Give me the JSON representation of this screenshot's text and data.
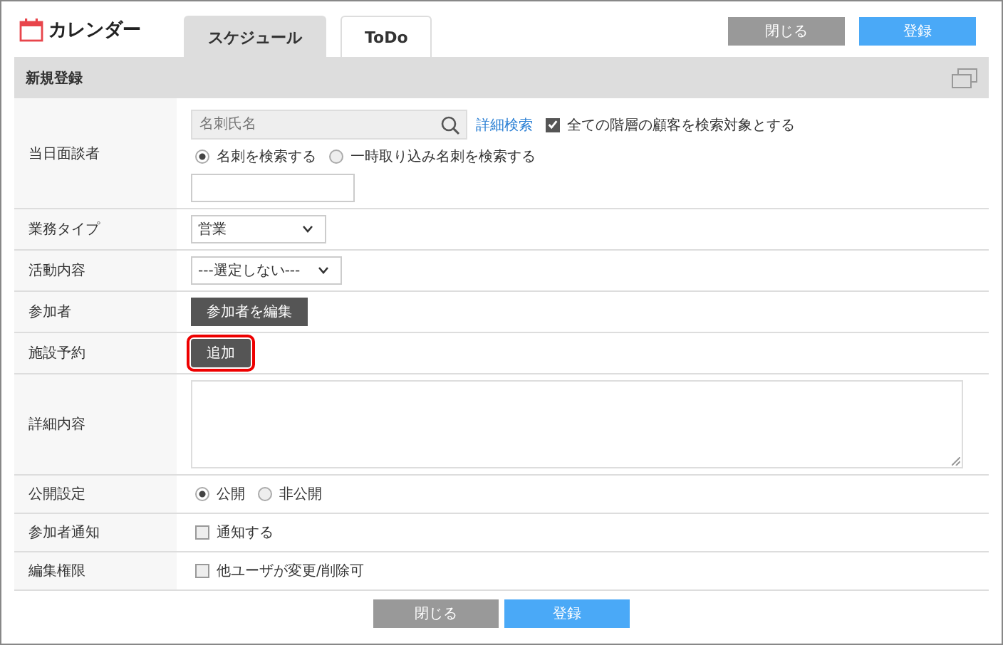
{
  "app": {
    "title": "カレンダー"
  },
  "tabs": [
    {
      "label": "スケジュール",
      "selected": true
    },
    {
      "label": "ToDo",
      "selected": false
    }
  ],
  "header_buttons": [
    {
      "label": "閉じる",
      "kind": "secondary"
    },
    {
      "label": "登録",
      "kind": "primary"
    }
  ],
  "section": {
    "title": "新規登録"
  },
  "rows": [
    {
      "label": "当日面談者",
      "kind": "visitor",
      "placeholder": "名刺氏名",
      "link": "詳細検索",
      "checkbox": {
        "label": "全ての階層の顧客を検索対象とする",
        "checked": true
      },
      "options": [
        {
          "label": "名刺を検索する",
          "selected": true
        },
        {
          "label": "一時取り込み名刺を検索する",
          "selected": false
        }
      ]
    },
    {
      "label": "業務タイプ",
      "kind": "select",
      "value": "営業"
    },
    {
      "label": "活動内容",
      "kind": "select",
      "value": "---選定しない---"
    },
    {
      "label": "参加者",
      "kind": "button",
      "button": "参加者を編集",
      "highlighted": false
    },
    {
      "label": "施設予約",
      "kind": "button",
      "button": "追加",
      "highlighted": true
    },
    {
      "label": "詳細内容",
      "kind": "textarea"
    },
    {
      "label": "公開設定",
      "kind": "radio",
      "options": [
        {
          "label": "公開",
          "selected": true
        },
        {
          "label": "非公開",
          "selected": false
        }
      ]
    },
    {
      "label": "参加者通知",
      "kind": "checkbox",
      "checkbox": {
        "label": "通知する",
        "checked": false
      }
    },
    {
      "label": "編集権限",
      "kind": "checkbox",
      "checkbox": {
        "label": "他ユーザが変更/削除可",
        "checked": false
      }
    }
  ],
  "footer_buttons": [
    {
      "label": "閉じる",
      "kind": "secondary"
    },
    {
      "label": "登録",
      "kind": "primary"
    }
  ]
}
